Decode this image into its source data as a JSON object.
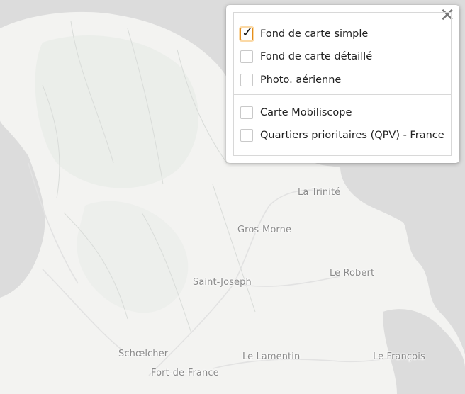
{
  "map": {
    "places": [
      {
        "id": "la-trinite",
        "name": "La Trinité"
      },
      {
        "id": "gros-morne",
        "name": "Gros-Morne"
      },
      {
        "id": "le-robert",
        "name": "Le Robert"
      },
      {
        "id": "saint-joseph",
        "name": "Saint-Joseph"
      },
      {
        "id": "schoelcher",
        "name": "Schœlcher"
      },
      {
        "id": "le-lamentin",
        "name": "Le Lamentin"
      },
      {
        "id": "le-francois",
        "name": "Le François"
      },
      {
        "id": "fort-de-france",
        "name": "Fort-de-France"
      }
    ]
  },
  "layers_panel": {
    "close_icon": "close-icon",
    "base_layers": [
      {
        "label": "Fond de carte simple",
        "checked": true
      },
      {
        "label": "Fond de carte détaillé",
        "checked": false
      },
      {
        "label": "Photo. aérienne",
        "checked": false
      }
    ],
    "overlays": [
      {
        "label": "Carte Mobiliscope",
        "checked": false
      },
      {
        "label": "Quartiers prioritaires (QPV) - France",
        "checked": false
      }
    ]
  },
  "colors": {
    "sea": "#dcdcdc",
    "land": "#f3f3f1",
    "relief": "#e8ebe8",
    "checkbox_focus": "#e38d1c"
  }
}
